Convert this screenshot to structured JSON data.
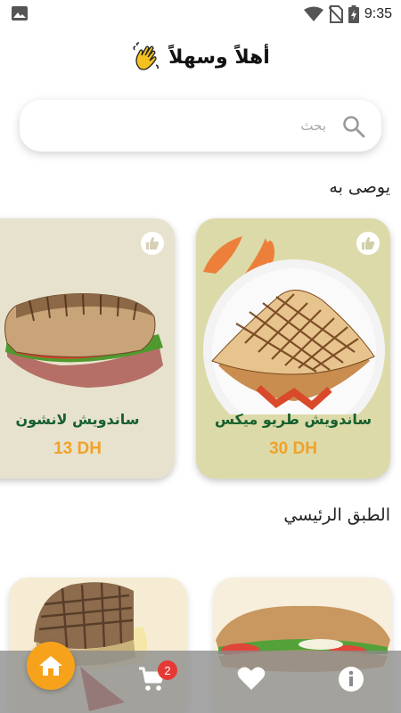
{
  "status_bar": {
    "time": "9:35",
    "left_icon": "image-icon",
    "right_icons": [
      "wifi-icon",
      "no-sim-icon",
      "battery-charging-icon"
    ]
  },
  "header": {
    "greeting": "أهلاً وسهلاً",
    "greeting_icon": "waving-hand-icon"
  },
  "search": {
    "placeholder": "بحث",
    "icon": "search-icon"
  },
  "recommended": {
    "title": "يوصى به",
    "items": [
      {
        "name": "ساندويش طريو ميكس",
        "price": "30 DH",
        "like_icon": "thumbs-up-icon"
      },
      {
        "name": "ساندويش لانشون",
        "price": "13 DH",
        "like_icon": "thumbs-up-icon"
      }
    ]
  },
  "main_dish": {
    "title": "الطبق الرئيسي"
  },
  "bottom_nav": {
    "items": [
      {
        "icon": "home-icon",
        "active": true
      },
      {
        "icon": "cart-icon",
        "badge": "2"
      },
      {
        "icon": "heart-icon"
      },
      {
        "icon": "info-icon"
      }
    ]
  },
  "colors": {
    "accent": "#f7a21b",
    "name_green": "#17602f",
    "price_orange": "#f0a22a",
    "badge_red": "#e53935"
  }
}
